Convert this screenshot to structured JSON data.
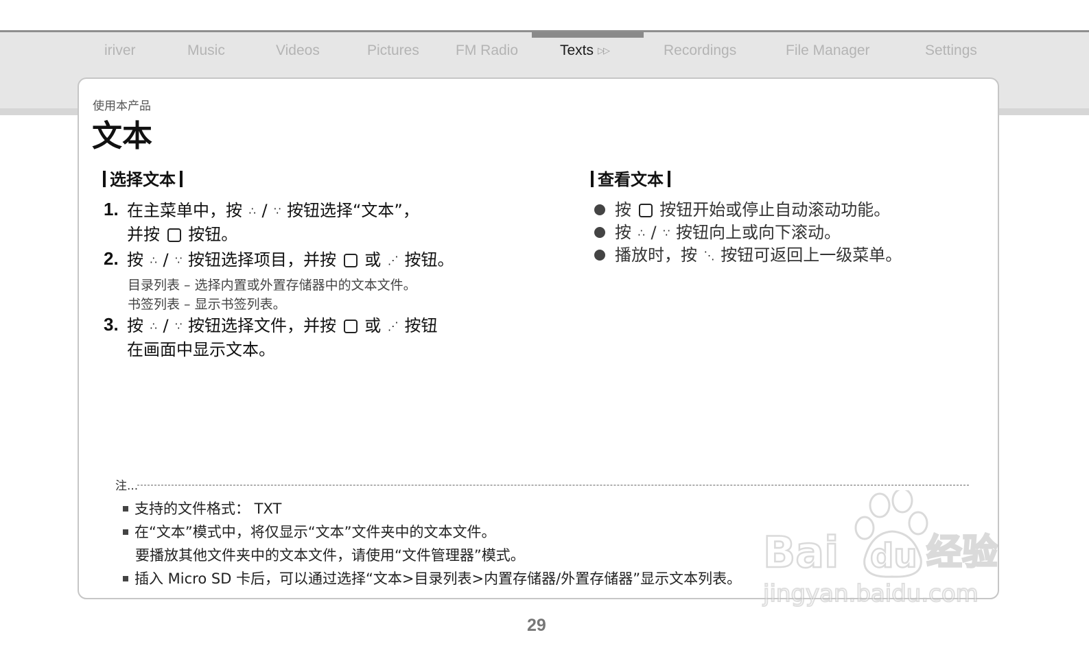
{
  "nav": {
    "items": [
      "iriver",
      "Music",
      "Videos",
      "Pictures",
      "FM Radio",
      "Texts",
      "Recordings",
      "File Manager",
      "Settings"
    ],
    "active": "Texts"
  },
  "breadcrumb": "使用本产品",
  "title": "文本",
  "left_section": {
    "heading": "选择文本",
    "steps": [
      {
        "num": "1.",
        "lines": [
          "在主菜单中，按 {up} / {down} 按钮选择“文本”，",
          "并按 {ok} 按钮。"
        ]
      },
      {
        "num": "2.",
        "lines": [
          "按 {up} / {down} 按钮选择项目，并按 {ok} 或 {right} 按钮。"
        ]
      },
      {
        "num": "3.",
        "lines": [
          "按 {up} / {down} 按钮选择文件，并按 {ok} 或 {right} 按钮",
          "在画面中显示文本。"
        ]
      }
    ],
    "sub_notes": [
      "目录列表 – 选择内置或外置存储器中的文本文件。",
      "书签列表 – 显示书签列表。"
    ]
  },
  "right_section": {
    "heading": "查看文本",
    "bullets": [
      "按 {ok} 按钮开始或停止自动滚动功能。",
      "按 {up} / {down} 按钮向上或向下滚动。",
      "播放时，按 {left} 按钮可返回上一级菜单。"
    ]
  },
  "notes": {
    "label": "注",
    "items": [
      "支持的文件格式： TXT",
      "在“文本”模式中，将仅显示“文本”文件夹中的文本文件。",
      "要播放其他文件夹中的文本文件，请使用“文件管理器”模式。",
      "插入 Micro SD 卡后，可以通过选择“文本>目录列表>内置存储器/外置存储器”显示文本列表。"
    ]
  },
  "page_number": "29",
  "watermark": {
    "brand": "Bai du 经验",
    "url": "jingyan.baidu.com"
  },
  "icons": {
    "up": "up-button-icon",
    "down": "down-button-icon",
    "ok": "ok-button-icon",
    "right": "right-button-icon",
    "left": "left-button-icon"
  }
}
